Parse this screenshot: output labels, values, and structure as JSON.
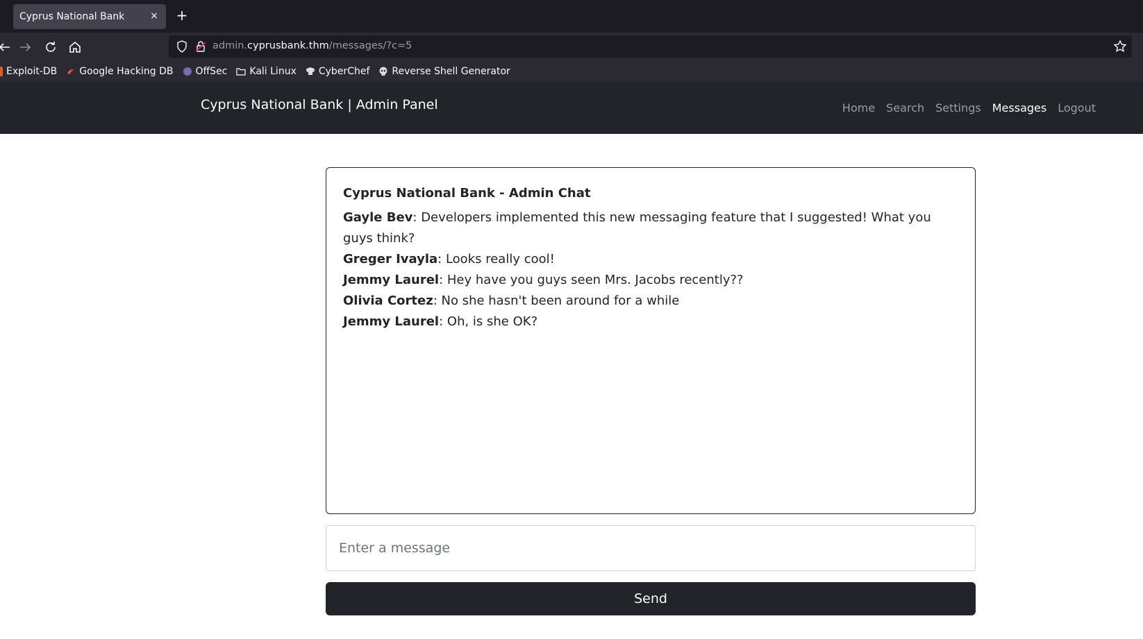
{
  "browser": {
    "tab_title": "Cyprus National Bank",
    "tab_close": "×",
    "new_tab": "+",
    "url_host_prefix": "admin.",
    "url_host": "cyprusbank.thm",
    "url_path": "/messages/?c=5",
    "bookmarks": [
      {
        "label": "Exploit-DB",
        "icon": "exploit-db-icon",
        "color": "#e05a2b"
      },
      {
        "label": "Google Hacking DB",
        "icon": "ghdb-icon",
        "color": "#e05a2b"
      },
      {
        "label": "OffSec",
        "icon": "offsec-icon",
        "color": "#5a6ee0"
      },
      {
        "label": "Kali Linux",
        "icon": "folder-icon",
        "color": "#fbfbfe"
      },
      {
        "label": "CyberChef",
        "icon": "chef-hat-icon",
        "color": "#dddddd"
      },
      {
        "label": "Reverse Shell Generator",
        "icon": "skull-icon",
        "color": "#dddddd"
      }
    ]
  },
  "site": {
    "brand": "Cyprus National Bank | Admin Panel",
    "nav": [
      "Home",
      "Search",
      "Settings",
      "Messages",
      "Logout"
    ],
    "active_nav": "Messages"
  },
  "chat": {
    "title": "Cyprus National Bank - Admin Chat",
    "messages": [
      {
        "author": "Gayle Bev",
        "text": ": Developers implemented this new messaging feature that I suggested! What you guys think?"
      },
      {
        "author": "Greger Ivayla",
        "text": ": Looks really cool!"
      },
      {
        "author": "Jemmy Laurel",
        "text": ": Hey have you guys seen Mrs. Jacobs recently??"
      },
      {
        "author": "Olivia Cortez",
        "text": ": No she hasn't been around for a while"
      },
      {
        "author": "Jemmy Laurel",
        "text": ": Oh, is she OK?"
      }
    ],
    "input_placeholder": "Enter a message",
    "send_label": "Send"
  },
  "colors": {
    "navbar_bg": "#212529",
    "browser_bg": "#2b2a33",
    "tabbar_bg": "#1c1b22"
  }
}
